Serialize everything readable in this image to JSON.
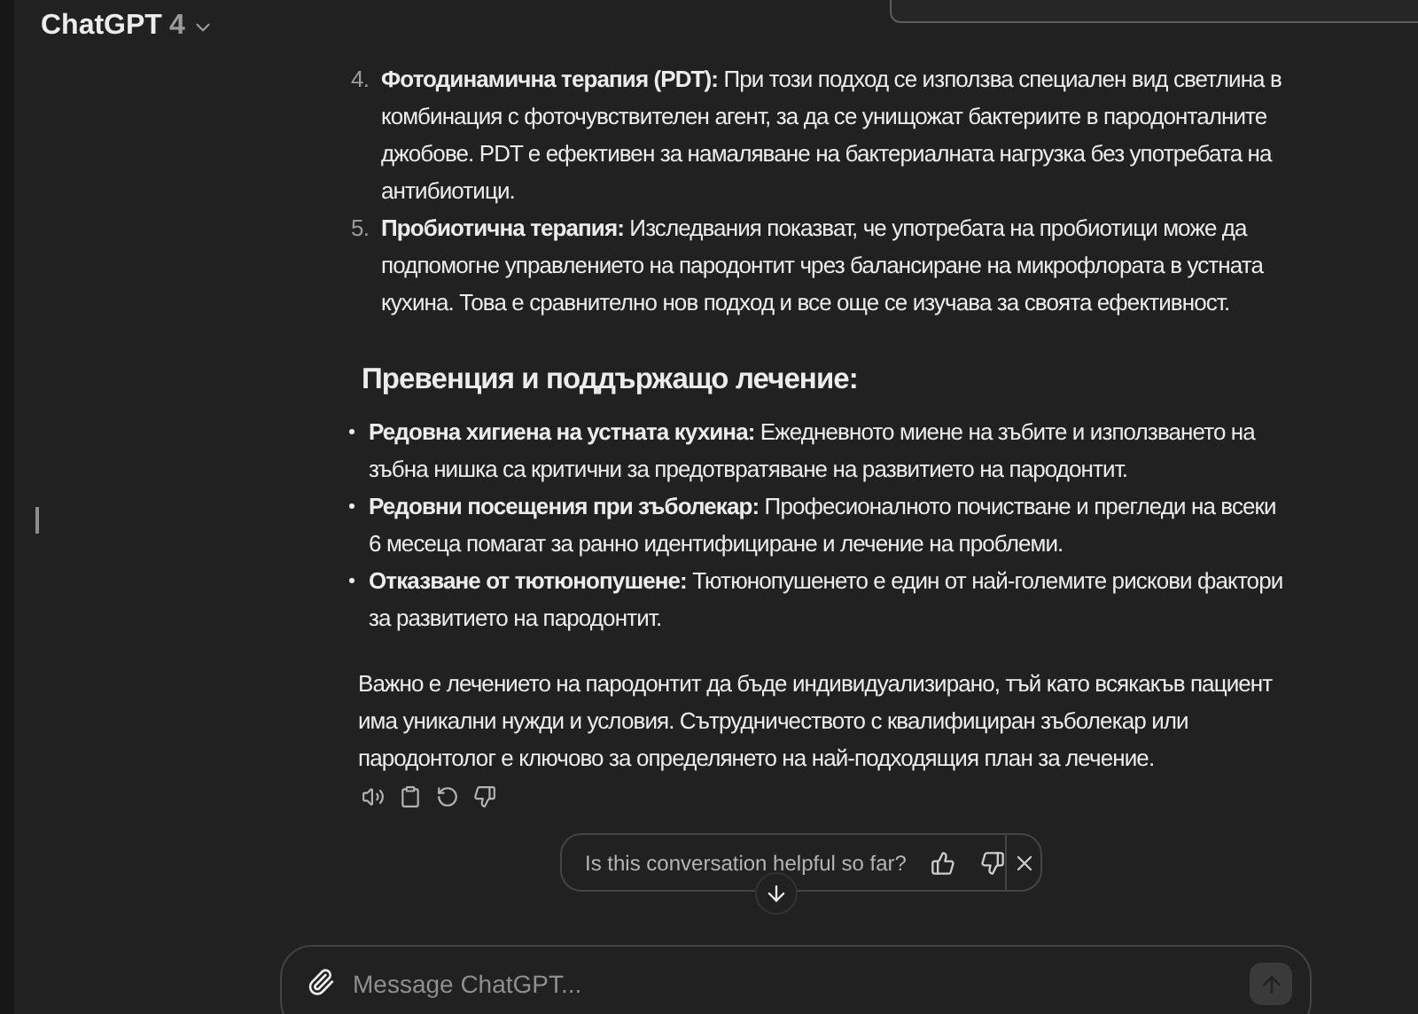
{
  "header": {
    "title": "ChatGPT",
    "version": "4"
  },
  "numbered_items": [
    {
      "number": "4.",
      "lead": "Фотодинамична терапия (PDT):",
      "text": "При този подход се използва специален вид светлина в комбинация с фоточувствителен агент, за да се унищожат бактериите в пародонталните джобове. PDT е ефективен за намаляване на бактериалната нагрузка без употребата на антибиотици."
    },
    {
      "number": "5.",
      "lead": "Пробиотична терапия:",
      "text": "Изследвания показват, че употребата на пробиотици може да подпомогне управлението на пародонтит чрез балансиране на микрофлората в устната кухина. Това е сравнително нов подход и все още се изучава за своята ефективност."
    }
  ],
  "heading": "Превенция и поддържащо лечение:",
  "bullets": [
    {
      "lead": "Редовна хигиена на устната кухина:",
      "text": "Ежедневното миене на зъбите и използването на зъбна нишка са критични за предотвратяване на развитието на пародонтит."
    },
    {
      "lead": "Редовни посещения при зъболекар:",
      "text": "Професионалното почистване и прегледи на всеки 6 месеца помагат за ранно идентифициране и лечение на проблеми."
    },
    {
      "lead": "Отказване от тютюнопушене:",
      "text": "Тютюнопушенето е един от най-големите рискови фактори за развитието на пародонтит."
    }
  ],
  "paragraph": "Важно е лечението на пародонтит да бъде индивидуализирано, тъй като всякакъв пациент има уникални нужди и условия. Сътрудничеството с квалифициран зъболекар или пародонтолог е ключово за определянето на най-подходящия план за лечение.",
  "feedback": {
    "question": "Is this conversation helpful so far?"
  },
  "composer": {
    "placeholder": "Message ChatGPT..."
  }
}
